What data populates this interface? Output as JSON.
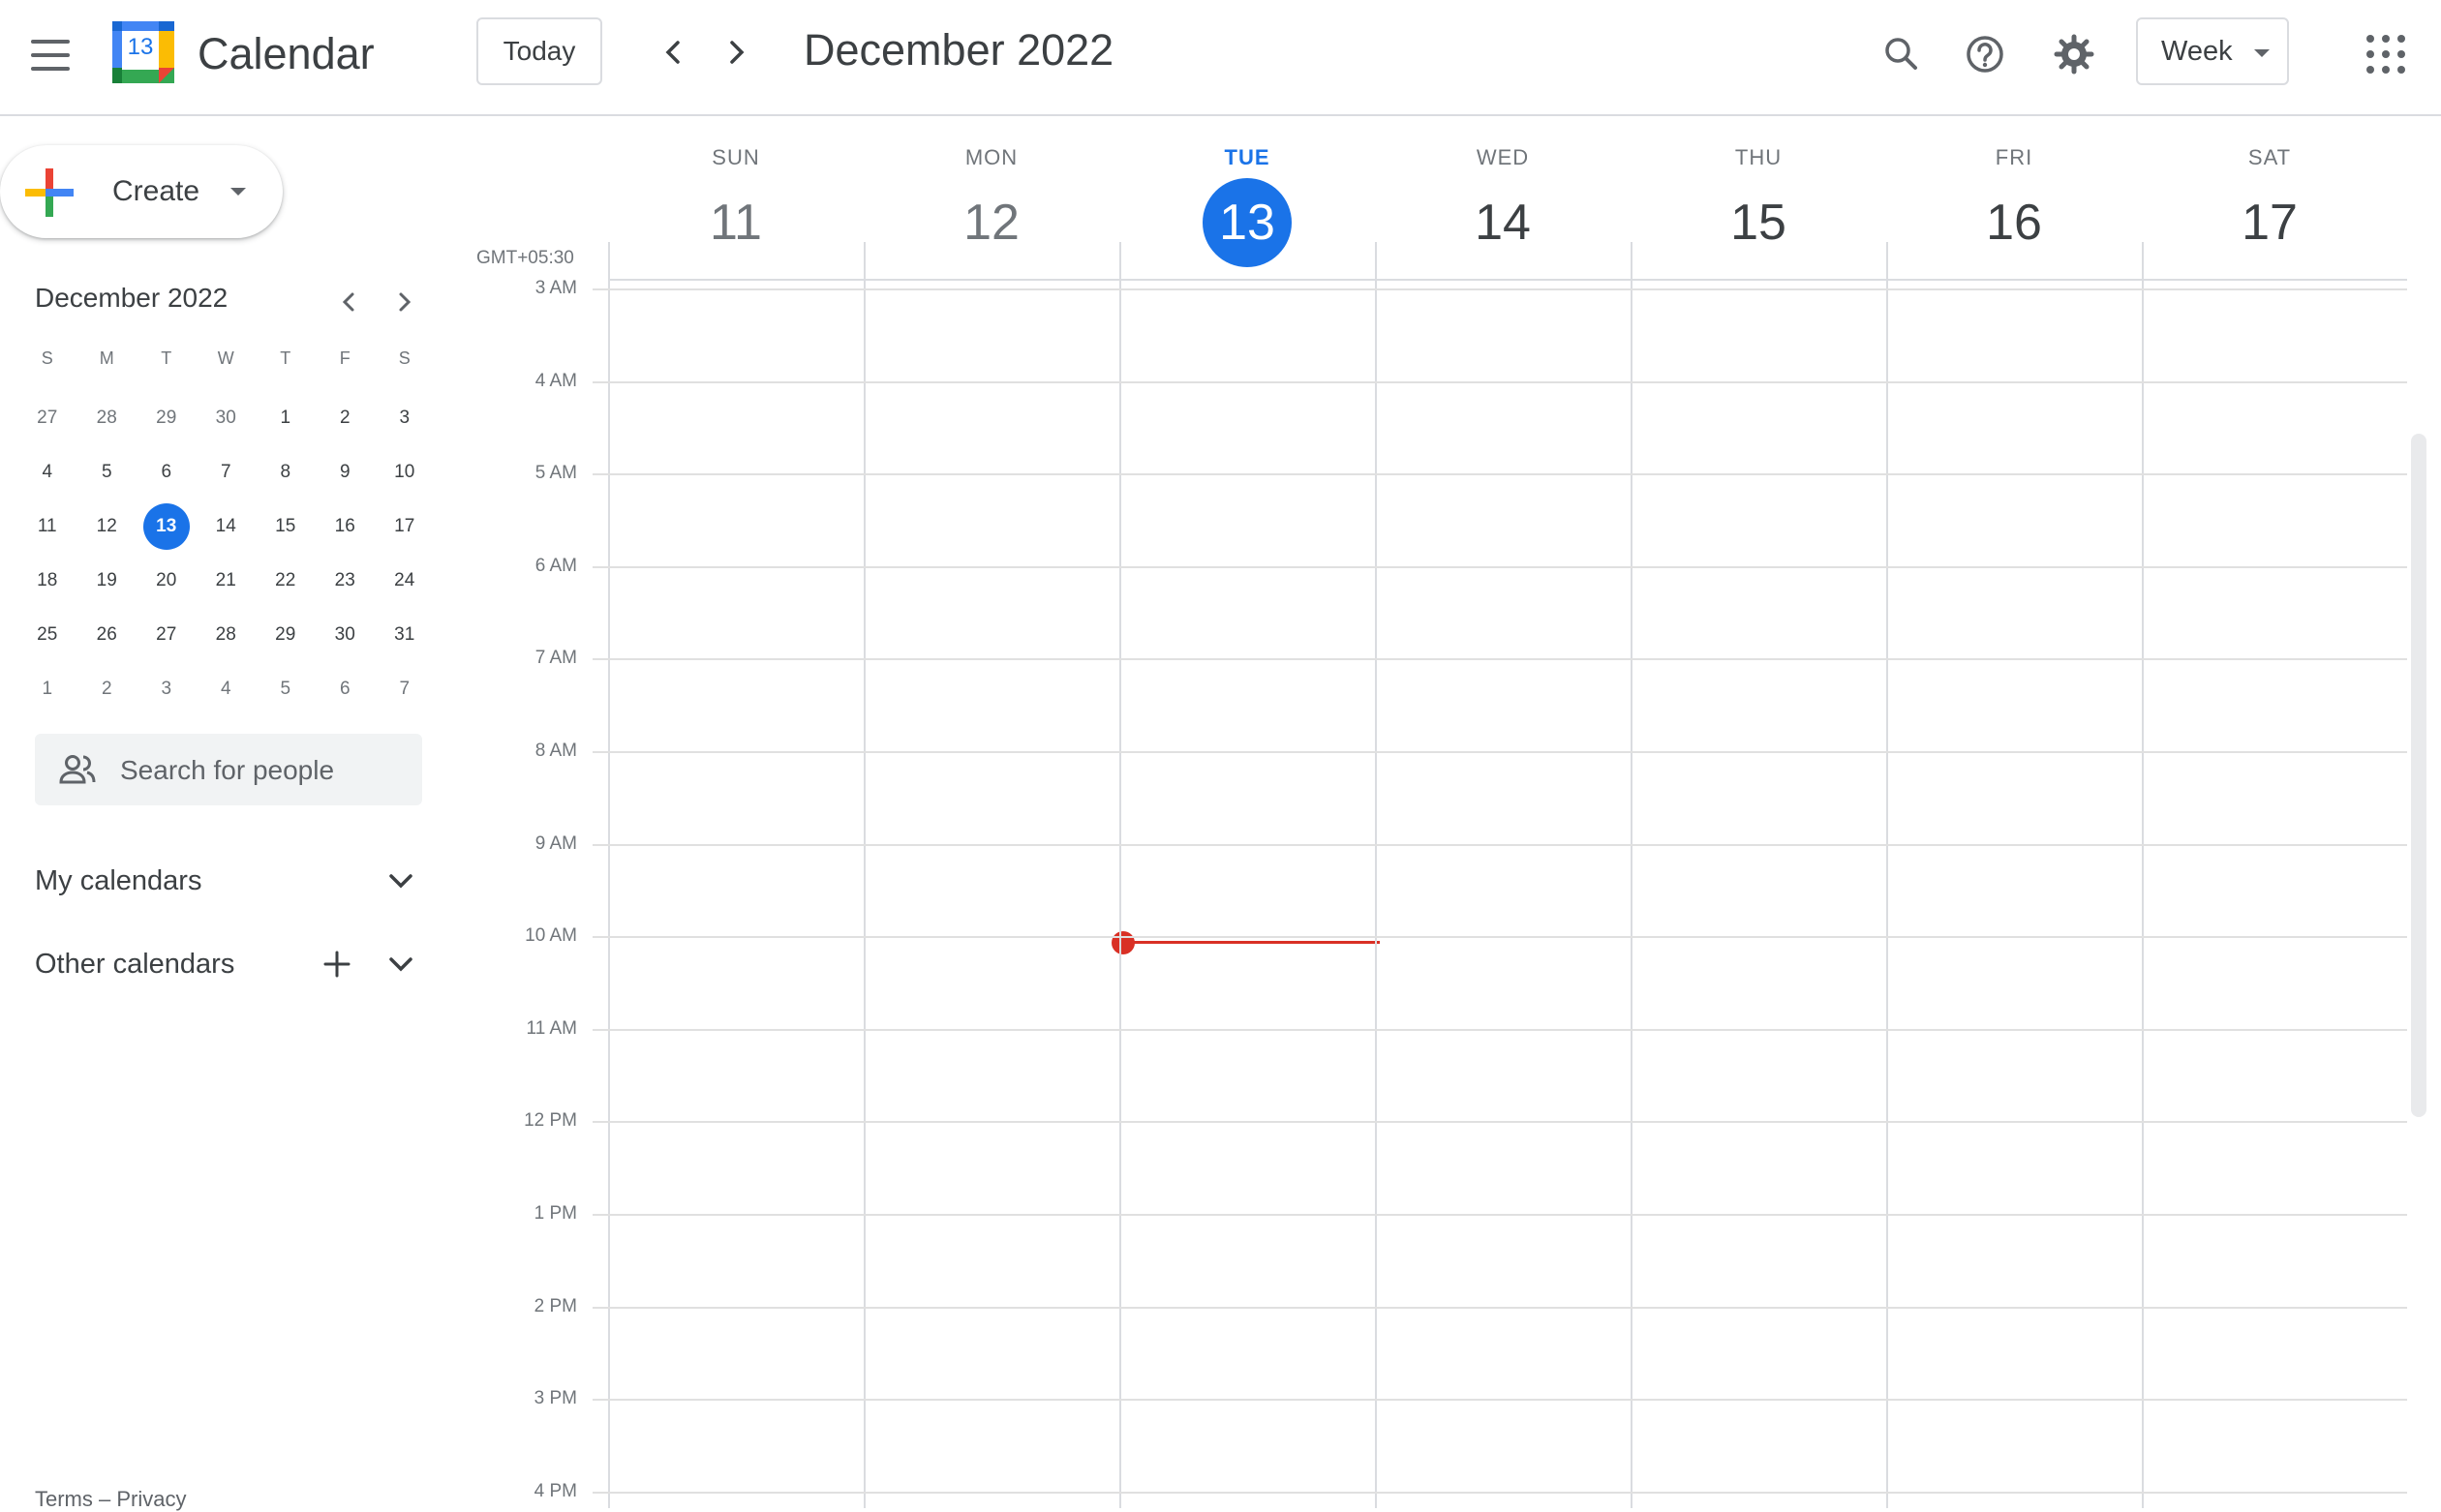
{
  "header": {
    "app_name": "Calendar",
    "logo_day": "13",
    "today_label": "Today",
    "current_range": "December 2022",
    "view_label": "Week"
  },
  "icons": {
    "menu": "hamburger-menu-icon",
    "prev": "chevron-left-icon",
    "next": "chevron-right-icon",
    "search": "search-icon",
    "help": "help-circle-icon",
    "settings": "gear-icon",
    "apps": "apps-grid-icon"
  },
  "colors": {
    "accent": "#1a73e8",
    "now_indicator": "#d93025",
    "logo_blue": "#4285f4",
    "logo_red": "#ea4335",
    "logo_yellow": "#fbbc04",
    "logo_green": "#34a853"
  },
  "sidebar": {
    "create_label": "Create",
    "mini_calendar": {
      "title": "December 2022",
      "weekdays": [
        "S",
        "M",
        "T",
        "W",
        "T",
        "F",
        "S"
      ],
      "weeks": [
        [
          "27",
          "28",
          "29",
          "30",
          "1",
          "2",
          "3"
        ],
        [
          "4",
          "5",
          "6",
          "7",
          "8",
          "9",
          "10"
        ],
        [
          "11",
          "12",
          "13",
          "14",
          "15",
          "16",
          "17"
        ],
        [
          "18",
          "19",
          "20",
          "21",
          "22",
          "23",
          "24"
        ],
        [
          "25",
          "26",
          "27",
          "28",
          "29",
          "30",
          "31"
        ],
        [
          "1",
          "2",
          "3",
          "4",
          "5",
          "6",
          "7"
        ]
      ],
      "today": "13"
    },
    "search_people_placeholder": "Search for people",
    "my_calendars_label": "My calendars",
    "other_calendars_label": "Other calendars",
    "footer": "Terms – Privacy"
  },
  "week": {
    "timezone": "GMT+05:30",
    "days": [
      {
        "dow": "SUN",
        "num": "11"
      },
      {
        "dow": "MON",
        "num": "12"
      },
      {
        "dow": "TUE",
        "num": "13"
      },
      {
        "dow": "WED",
        "num": "14"
      },
      {
        "dow": "THU",
        "num": "15"
      },
      {
        "dow": "FRI",
        "num": "16"
      },
      {
        "dow": "SAT",
        "num": "17"
      }
    ],
    "today_index": 2,
    "hours": [
      "3 AM",
      "4 AM",
      "5 AM",
      "6 AM",
      "7 AM",
      "8 AM",
      "9 AM",
      "10 AM",
      "11 AM",
      "12 PM",
      "1 PM",
      "2 PM",
      "3 PM",
      "4 PM"
    ]
  }
}
